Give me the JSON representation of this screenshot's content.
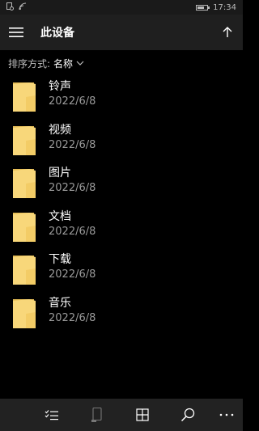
{
  "status_bar": {
    "time": "17:34",
    "battery_level": 0.7
  },
  "header": {
    "title": "此设备"
  },
  "sort": {
    "label": "排序方式:",
    "value": "名称"
  },
  "folders": [
    {
      "name": "铃声",
      "date": "2022/6/8"
    },
    {
      "name": "视频",
      "date": "2022/6/8"
    },
    {
      "name": "图片",
      "date": "2022/6/8"
    },
    {
      "name": "文档",
      "date": "2022/6/8"
    },
    {
      "name": "下载",
      "date": "2022/6/8"
    },
    {
      "name": "音乐",
      "date": "2022/6/8"
    }
  ],
  "app_bar": {
    "buttons": [
      "select-icon",
      "device-icon",
      "grid-view-icon",
      "search-icon",
      "more-icon"
    ]
  },
  "colors": {
    "folder": "#f8d77a",
    "folder_back": "#e6bd55",
    "background": "#000000",
    "header": "#1f1f1f"
  }
}
